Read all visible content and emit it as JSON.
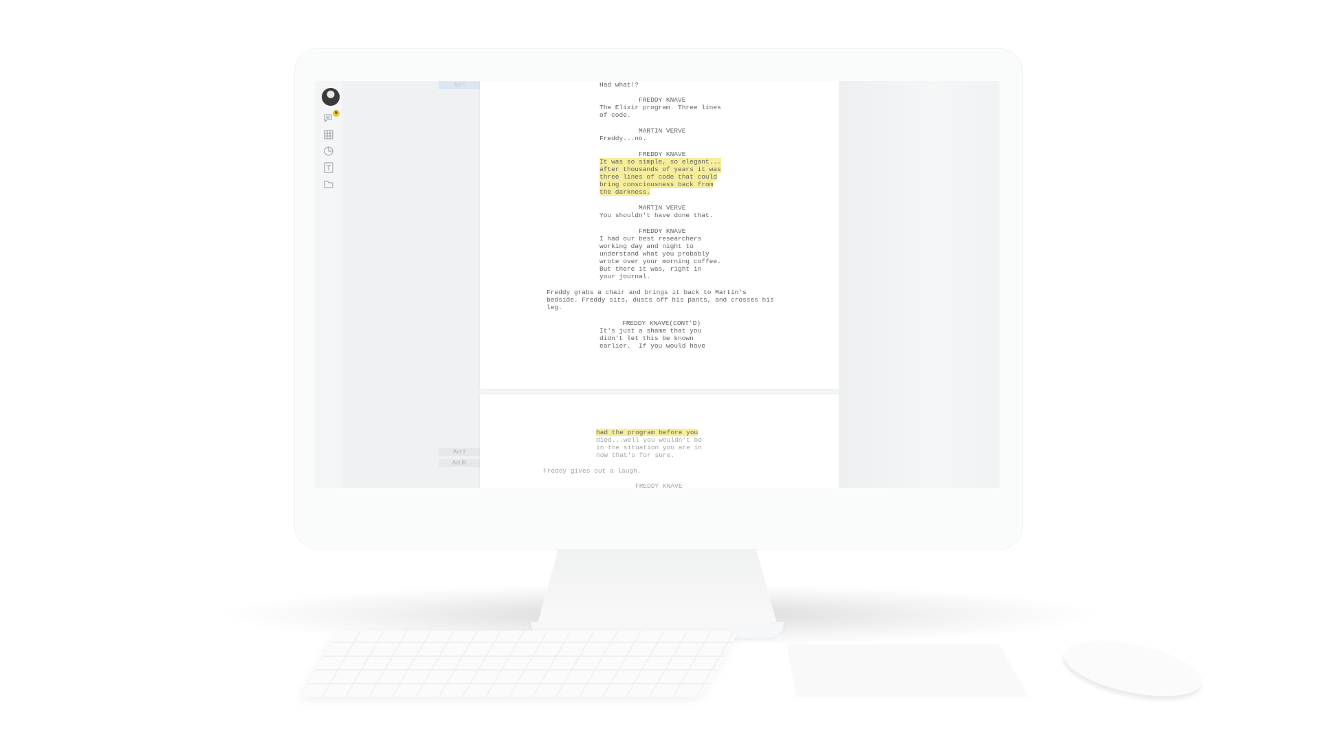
{
  "app": {
    "rail": {
      "notification_count": "6",
      "icons": [
        "avatar",
        "comments-icon",
        "grid-icon",
        "analytics-icon",
        "text-icon",
        "folder-icon"
      ]
    },
    "acts": [
      {
        "label": "Act I",
        "active": true
      },
      {
        "label": "Act II",
        "active": false
      },
      {
        "label": "Act III",
        "active": false
      }
    ]
  },
  "script": {
    "page1": [
      {
        "type": "dialogue",
        "text": "Had what!?"
      },
      {
        "type": "character",
        "text": "FREDDY KNAVE"
      },
      {
        "type": "dialogue",
        "text": "The Elixir program. Three lines"
      },
      {
        "type": "dialogue",
        "text": "of code."
      },
      {
        "type": "character",
        "text": "MARTIN VERVE"
      },
      {
        "type": "dialogue",
        "text": "Freddy...no."
      },
      {
        "type": "character",
        "text": "FREDDY KNAVE"
      },
      {
        "type": "dialogue_hl",
        "text": "It was so simple, so elegant..."
      },
      {
        "type": "dialogue_hl",
        "text": "after thousands of years it was"
      },
      {
        "type": "dialogue_hl",
        "text": "three lines of code that could"
      },
      {
        "type": "dialogue_hl",
        "text": "bring consciousness back from"
      },
      {
        "type": "dialogue_hl",
        "text": "the darkness."
      },
      {
        "type": "character",
        "text": "MARTIN VERVE"
      },
      {
        "type": "dialogue",
        "text": "You shouldn't have done that."
      },
      {
        "type": "character",
        "text": "FREDDY KNAVE"
      },
      {
        "type": "dialogue",
        "text": "I had our best researchers"
      },
      {
        "type": "dialogue",
        "text": "working day and night to"
      },
      {
        "type": "dialogue",
        "text": "understand what you probably"
      },
      {
        "type": "dialogue",
        "text": "wrote over your morning coffee."
      },
      {
        "type": "dialogue",
        "text": "But there it was, right in"
      },
      {
        "type": "dialogue",
        "text": "your journal."
      },
      {
        "type": "action",
        "text": "Freddy grabs a chair and brings it back to Martin's"
      },
      {
        "type": "action",
        "text": "bedside. Freddy sits, dusts off his pants, and crosses his"
      },
      {
        "type": "action",
        "text": "leg."
      },
      {
        "type": "character",
        "text": "FREDDY KNAVE(CONT'D)"
      },
      {
        "type": "dialogue",
        "text": "It's just a shame that you"
      },
      {
        "type": "dialogue",
        "text": "didn't let this be known"
      },
      {
        "type": "dialogue",
        "text": "earlier.  If you would have"
      }
    ],
    "page2": [
      {
        "type": "dialogue_hl",
        "text": "had the program before you"
      },
      {
        "type": "dialogue",
        "text": "died...well you wouldn't be"
      },
      {
        "type": "dialogue",
        "text": "in the situation you are in"
      },
      {
        "type": "dialogue",
        "text": "now that's for sure."
      },
      {
        "type": "action",
        "text": "Freddy gives out a laugh."
      },
      {
        "type": "character",
        "text": "FREDDY KNAVE"
      }
    ]
  },
  "colors": {
    "highlight": "#f6ed9a",
    "badge": "#f5c518",
    "text": "#5f6368"
  }
}
